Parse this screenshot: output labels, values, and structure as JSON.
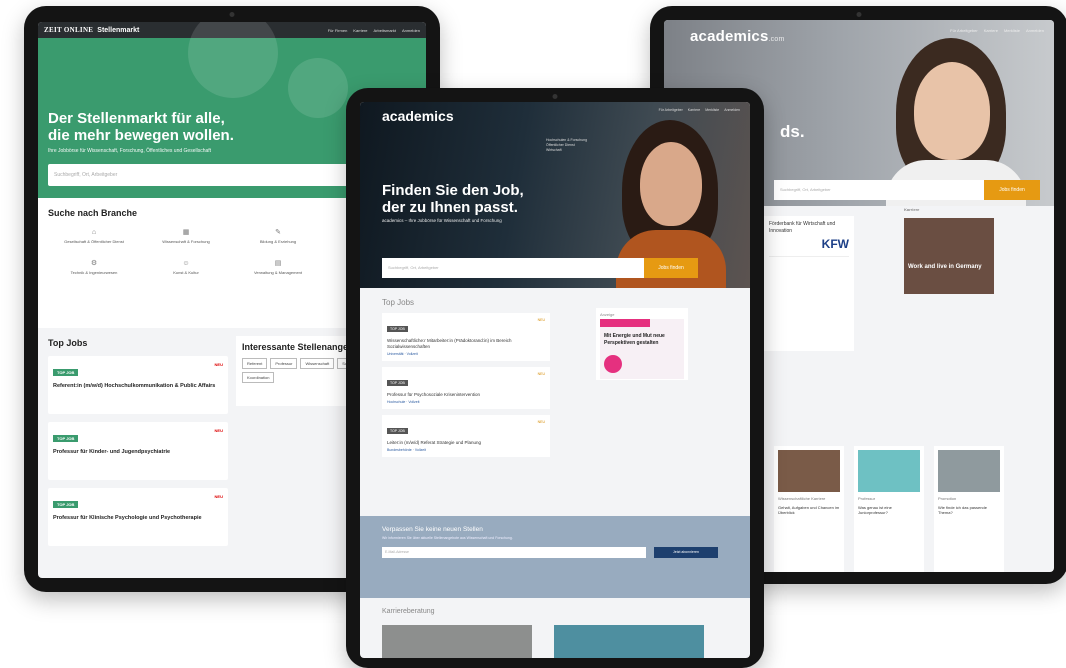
{
  "left_tablet": {
    "brand": "ZEIT ONLINE",
    "brand_sub": "Stellenmarkt",
    "nav": [
      "Für Firmen",
      "Karriere",
      "Arbeitsmarkt",
      "Anmelden"
    ],
    "hero_title_1": "Der Stellenmarkt für alle,",
    "hero_title_2": "die mehr bewegen wollen.",
    "hero_text": "Ihre Jobbörse für Wissenschaft, Forschung, Öffentliches und Gesellschaft",
    "search_placeholder": "Suchbegriff, Ort, Arbeitgeber",
    "branche_title": "Suche nach Branche",
    "branches": [
      {
        "icon": "⌂",
        "label": "Gesellschaft & Öffentlicher Dienst"
      },
      {
        "icon": "▦",
        "label": "Wissenschaft & Forschung"
      },
      {
        "icon": "✎",
        "label": "Bildung & Erziehung"
      },
      {
        "icon": "⚕",
        "label": "Gesundheit & Soziales"
      },
      {
        "icon": "⚙",
        "label": "Technik & Ingenieurwesen"
      },
      {
        "icon": "☺",
        "label": "Kunst & Kultur"
      },
      {
        "icon": "▤",
        "label": "Verwaltung & Management"
      },
      {
        "icon": "◎",
        "label": "Wirtschaft & Finanzen"
      }
    ],
    "top_jobs_title": "Top Jobs",
    "top_jobs": [
      {
        "badge": "TOP JOB",
        "status": "NEU",
        "title": "Referent:in (m/w/d) Hochschulkommunikation & Public Affairs"
      },
      {
        "badge": "TOP JOB",
        "status": "NEU",
        "title": "Professur für Kinder- und Jugendpsychiatrie"
      },
      {
        "badge": "TOP JOB",
        "status": "NEU",
        "title": "Professur für Klinische Psychologie und Psychotherapie"
      }
    ],
    "interest_title": "Interessante Stellenange",
    "chips": [
      "Referent",
      "Professur",
      "Wissenschaft",
      "Sozialarbeiter",
      "Lehrer",
      "Koordination"
    ]
  },
  "right_tablet": {
    "logo": "academics",
    "logo_suffix": ".com",
    "nav": [
      "Für Arbeitgeber",
      "Karriere",
      "Merkliste",
      "Anmelden"
    ],
    "hero_partial_text": "ds.",
    "search_placeholder": "Suchbegriff, Ort, Arbeitgeber",
    "search_button": "Jobs finden",
    "employer_card_text": "Förderbank für Wirtschaft und Innovation",
    "employer_logo": "KFW",
    "feature_label": "Karriere",
    "feature_title": "Work and live in Germany",
    "articles": [
      {
        "title": "Wissenschaftliche Karriere",
        "text": "Gehalt, Aufgaben und Chancen im Überblick"
      },
      {
        "title": "Professur",
        "text": "Was genau ist eine Juniorprofessur?"
      },
      {
        "title": "Promotion",
        "text": "Wie finde ich das passende Thema?"
      }
    ]
  },
  "center_tablet": {
    "logo": "academics",
    "nav": [
      "Für Arbeitgeber",
      "Karriere",
      "Merkliste",
      "Anmelden"
    ],
    "hero_list": [
      "Hochschulen & Forschung",
      "Öffentlicher Dienst",
      "Wirtschaft"
    ],
    "hero_title_1": "Finden Sie den Job,",
    "hero_title_2": "der zu Ihnen passt.",
    "hero_text": "academics – Ihre Jobbörse für Wissenschaft und Forschung",
    "search_placeholder": "Suchbegriff, Ort, Arbeitgeber",
    "search_button": "Jobs finden",
    "top_jobs_title": "Top Jobs",
    "top_jobs": [
      {
        "badge": "TOP JOB",
        "status": "NEU",
        "title": "Wissenschaftliche:r Mitarbeiter:in (Prädoktorand:in) im Bereich Sozialwissenschaften",
        "meta": "Universität · Vollzeit"
      },
      {
        "badge": "TOP JOB",
        "status": "NEU",
        "title": "Professur für Psychosoziale Krisenintervention",
        "meta": "Hochschule · Vollzeit"
      },
      {
        "badge": "TOP JOB",
        "status": "NEU",
        "title": "Leiter:in (m/w/d) Referat Strategie und Planung",
        "meta": "Bundesbehörde · Vollzeit"
      }
    ],
    "ad_label": "Anzeige",
    "ad_text": "Mit Energie und Mut neue Perspektiven gestalten",
    "newsletter_title": "Verpassen Sie keine neuen Stellen",
    "newsletter_text": "Wir informieren Sie über aktuelle Stellenangebote aus Wissenschaft und Forschung.",
    "newsletter_placeholder": "E-Mail-Adresse",
    "newsletter_button": "Jetzt abonnieren",
    "career_title": "Karriereberatung"
  },
  "colors": {
    "zeit_green": "#3a9b6e",
    "academics_orange": "#e69a12",
    "newsletter_blue": "#98abbf",
    "kfw_blue": "#1c3f87"
  }
}
